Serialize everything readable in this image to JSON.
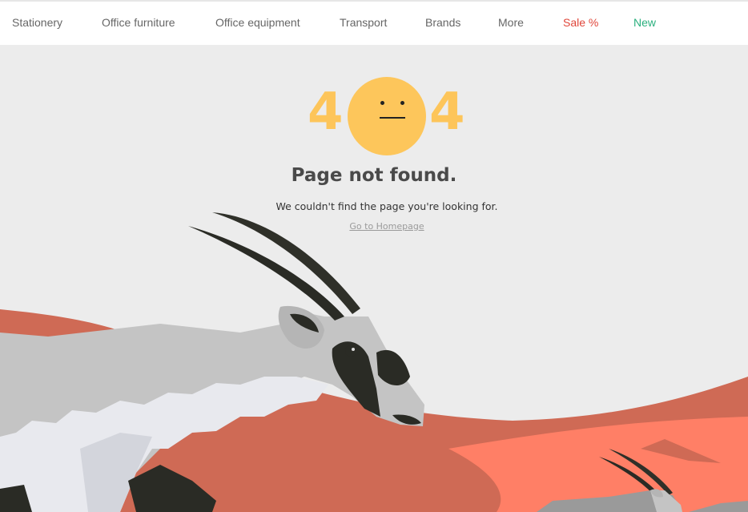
{
  "nav": {
    "items": [
      {
        "label": "Stationery"
      },
      {
        "label": "Office furniture"
      },
      {
        "label": "Office equipment"
      },
      {
        "label": "Transport"
      },
      {
        "label": "Brands"
      },
      {
        "label": "More"
      },
      {
        "label": "Sale %"
      },
      {
        "label": "New"
      }
    ]
  },
  "error": {
    "digit_left": "4",
    "digit_right": "4",
    "title": "Page not found.",
    "message": "We couldn't find the page you're looking for.",
    "home_link": "Go to Homepage"
  },
  "colors": {
    "accent_yellow": "#fdc55a",
    "sale": "#e0463a",
    "new": "#2bb07e",
    "dune": "#cf6a55",
    "dune_light": "#ff7f66"
  }
}
